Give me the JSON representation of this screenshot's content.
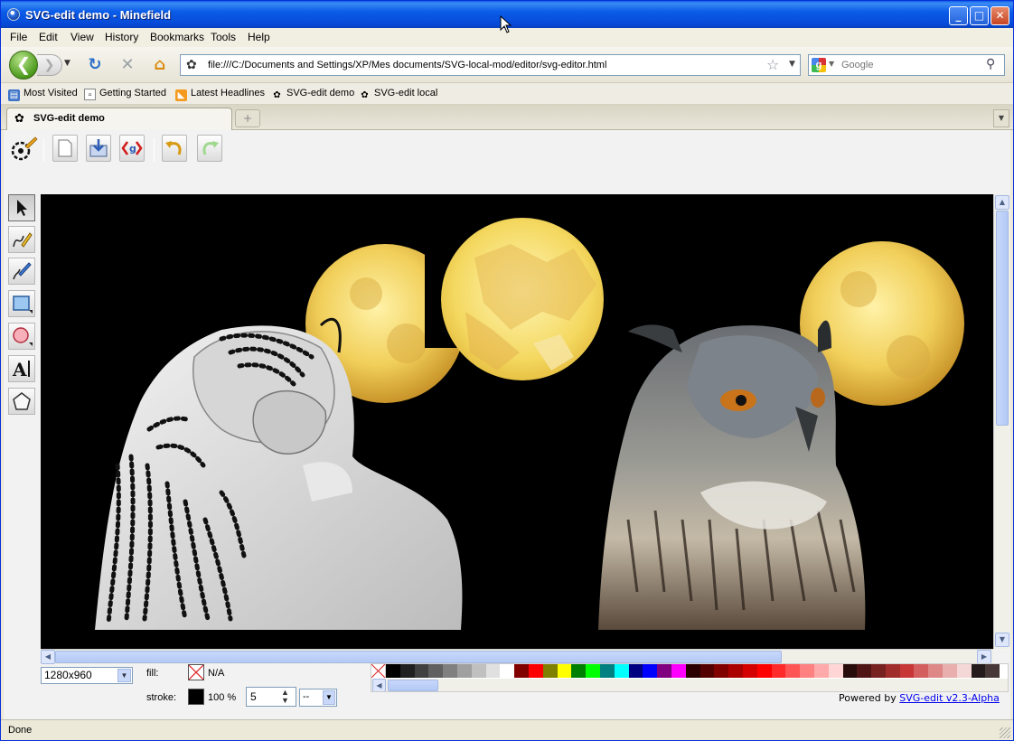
{
  "window": {
    "title": "SVG-edit demo - Minefield",
    "min_glyph": "_",
    "max_glyph": "□",
    "close_glyph": "✕"
  },
  "menu": [
    "File",
    "Edit",
    "View",
    "History",
    "Bookmarks",
    "Tools",
    "Help"
  ],
  "nav": {
    "back_glyph": "❮",
    "forward_glyph": "❯",
    "url": "file:///C:/Documents and Settings/XP/Mes documents/SVG-local-mod/editor/svg-editor.html",
    "search_placeholder": "Google"
  },
  "bookmarks": [
    {
      "label": "Most Visited",
      "icon": "most-visited-icon"
    },
    {
      "label": "Getting Started",
      "icon": "page-icon"
    },
    {
      "label": "Latest Headlines",
      "icon": "rss-icon"
    },
    {
      "label": "SVG-edit demo",
      "icon": "svg-edit-icon"
    },
    {
      "label": "SVG-edit local",
      "icon": "svg-edit-icon"
    }
  ],
  "tabs": [
    {
      "label": "SVG-edit demo",
      "active": true
    }
  ],
  "editor": {
    "toolbar": [
      "new-document",
      "save",
      "source-code",
      "undo",
      "redo"
    ],
    "tools": [
      "select",
      "pencil",
      "pen",
      "rectangle",
      "ellipse",
      "text",
      "polygon"
    ],
    "zoom_value": "1280x960",
    "fill_label": "fill:",
    "fill_value": "N/A",
    "stroke_label": "stroke:",
    "stroke_opacity": "100 %",
    "stroke_width": "5",
    "stroke_dash": "--",
    "powered_prefix": "Powered by ",
    "powered_link": "SVG-edit v2.3-Alpha",
    "palette": [
      "#000000",
      "#202020",
      "#404040",
      "#606060",
      "#808080",
      "#a0a0a0",
      "#c0c0c0",
      "#e0e0e0",
      "#ffffff",
      "#800000",
      "#ff0000",
      "#808000",
      "#ffff00",
      "#008000",
      "#00ff00",
      "#008080",
      "#00ffff",
      "#000080",
      "#0000ff",
      "#800080",
      "#ff00ff",
      "#2b0000",
      "#550000",
      "#800000",
      "#aa0000",
      "#d40000",
      "#ff0000",
      "#ff2a2a",
      "#ff5555",
      "#ff8080",
      "#ffaaaa",
      "#ffd5d5",
      "#280b0b",
      "#501616",
      "#782121",
      "#a02c2c",
      "#c83737",
      "#d35f5f",
      "#de8787",
      "#e9afaf",
      "#f4d7d7",
      "#241c1c",
      "#483737"
    ]
  },
  "status": "Done"
}
